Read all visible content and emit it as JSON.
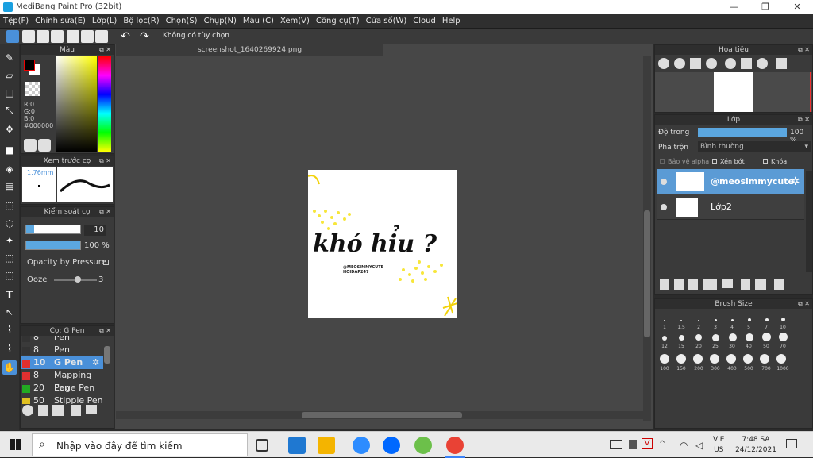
{
  "title": "MediBang Paint Pro (32bit)",
  "menu": [
    "Tệp(F)",
    "Chỉnh sửa(E)",
    "Lớp(L)",
    "Bộ lọc(R)",
    "Chọn(S)",
    "Chụp(N)",
    "Màu (C)",
    "Xem(V)",
    "Công cụ(T)",
    "Cửa sổ(W)",
    "Cloud",
    "Help"
  ],
  "toolbar": {
    "selection_status": "Không có tùy chọn"
  },
  "color_panel": {
    "title": "Màu",
    "r": "R:0",
    "g": "G:0",
    "b": "B:0",
    "hex": "#000000"
  },
  "brush_preview": {
    "title": "Xem trước cọ",
    "size": "1.76mm"
  },
  "brush_control": {
    "title": "Kiểm soát cọ",
    "size_value": "10",
    "opacity_value": "100 %",
    "opacity_label": "Opacity by Pressure",
    "ooze_label": "Ooze",
    "ooze_value": "3"
  },
  "brush_list": {
    "title": "Cọ: G Pen",
    "items": [
      {
        "size": "8",
        "name": "Pen",
        "color": "#333333"
      },
      {
        "size": "8",
        "name": "Pen (Sharp)",
        "color": "#333333"
      },
      {
        "size": "10",
        "name": "G Pen",
        "color": "#e03030"
      },
      {
        "size": "8",
        "name": "Mapping Pen",
        "color": "#e03030"
      },
      {
        "size": "20",
        "name": "Edge Pen",
        "color": "#22aa22"
      },
      {
        "size": "50",
        "name": "Stipple Pen",
        "color": "#e0c020"
      }
    ]
  },
  "document_tab": "screenshot_1640269924.png",
  "artwork": {
    "headline": "khó hỉu ?",
    "credit1": "@MEOSIMMYCUTE",
    "credit2": "HOIDAP247"
  },
  "navigator": {
    "title": "Hoa tiêu"
  },
  "layer_panel": {
    "title": "Lớp",
    "opacity_label": "Độ trong",
    "opacity_value": "100 %",
    "blend_label": "Pha trộn",
    "blend_value": "Bình thường",
    "protect_alpha": "Bảo vệ alpha",
    "clipping": "Xén bớt",
    "lock": "Khóa",
    "layers": [
      {
        "name": "@meosimmycute",
        "selected": true
      },
      {
        "name": "Lớp2",
        "selected": false
      }
    ]
  },
  "brush_size": {
    "title": "Brush Size",
    "labels": [
      "1",
      "1.5",
      "2",
      "3",
      "4",
      "5",
      "7",
      "10",
      "12",
      "15",
      "20",
      "25",
      "30",
      "40",
      "50",
      "70",
      "100",
      "150",
      "200",
      "300",
      "400",
      "500",
      "700",
      "1000"
    ]
  },
  "taskbar": {
    "search_placeholder": "Nhập vào đây để tìm kiếm",
    "lang1": "VIE",
    "lang2": "US",
    "time": "7:48 SA",
    "date": "24/12/2021"
  }
}
